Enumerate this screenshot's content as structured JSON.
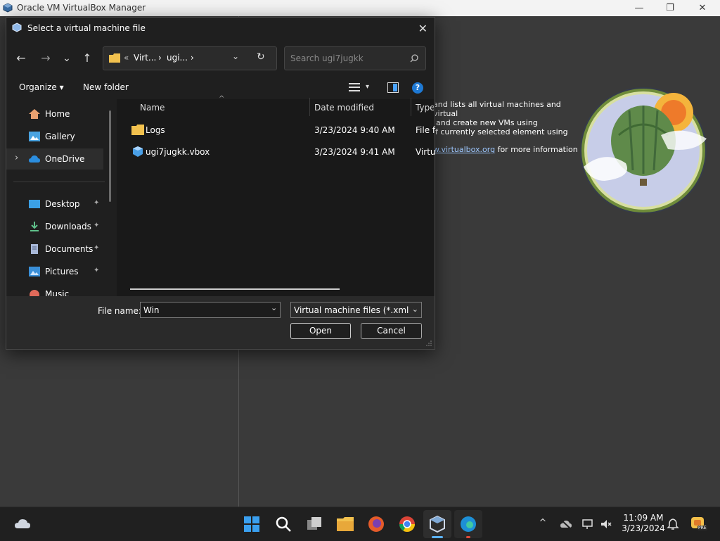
{
  "background_window": {
    "title": "Oracle VM VirtualBox Manager",
    "controls": {
      "minimize": "—",
      "maximize": "❐",
      "close": "✕"
    },
    "welcome": {
      "line1": "and lists all virtual machines and virtual",
      "line2": "and create new VMs using",
      "line3": "f currently selected element using",
      "link": "w.virtualbox.org",
      "link_suffix": " for more information"
    }
  },
  "dialog": {
    "title": "Select a virtual machine file",
    "close_glyph": "✕",
    "nav": {
      "back": "←",
      "forward": "→",
      "recent": "⌄",
      "up": "↑"
    },
    "address": {
      "prefix": "«",
      "segments": [
        "Virt...",
        "ugi..."
      ],
      "separator": "›",
      "dropdown": "⌄",
      "refresh": "↻"
    },
    "search": {
      "placeholder": "Search ugi7jugkk"
    },
    "toolbar": {
      "organize": "Organize",
      "organize_arrow": "▾",
      "new_folder": "New folder",
      "view_arrow": "▾",
      "help": "?"
    },
    "nav_pane": {
      "items": [
        {
          "label": "Home",
          "icon": "home-icon"
        },
        {
          "label": "Gallery",
          "icon": "gallery-icon"
        },
        {
          "label": "OneDrive",
          "icon": "onedrive-icon",
          "selected": true,
          "expander": "›"
        },
        {
          "label": "Desktop",
          "icon": "desktop-icon",
          "pinned": true
        },
        {
          "label": "Downloads",
          "icon": "downloads-icon",
          "pinned": true
        },
        {
          "label": "Documents",
          "icon": "documents-icon",
          "pinned": true
        },
        {
          "label": "Pictures",
          "icon": "pictures-icon",
          "pinned": true
        },
        {
          "label": "Music",
          "icon": "music-icon",
          "pinned": true
        }
      ],
      "pin_glyph": "📌"
    },
    "columns": {
      "name": "Name",
      "date": "Date modified",
      "type": "Type",
      "sort_glyph": "^"
    },
    "files": [
      {
        "name": "Logs",
        "date": "3/23/2024 9:40 AM",
        "type": "File folder",
        "icon": "folder-icon"
      },
      {
        "name": "ugi7jugkk.vbox",
        "date": "3/23/2024 9:41 AM",
        "type": "VirtualBox",
        "icon": "vbox-file-icon"
      }
    ],
    "file_name_label": "File name:",
    "file_name_value": "Win",
    "dropdown_glyph": "⌄",
    "file_type": "Virtual machine files (*.xml *.vbox)",
    "open_label": "Open",
    "cancel_label": "Cancel"
  },
  "taskbar": {
    "time": "11:09 AM",
    "date": "3/23/2024",
    "tray": {
      "chevron": "^"
    },
    "badge": "PRE"
  },
  "colors": {
    "dialog_bg": "#1f1f1f",
    "taskbar_bg": "#202020",
    "accent": "#0078d4"
  }
}
